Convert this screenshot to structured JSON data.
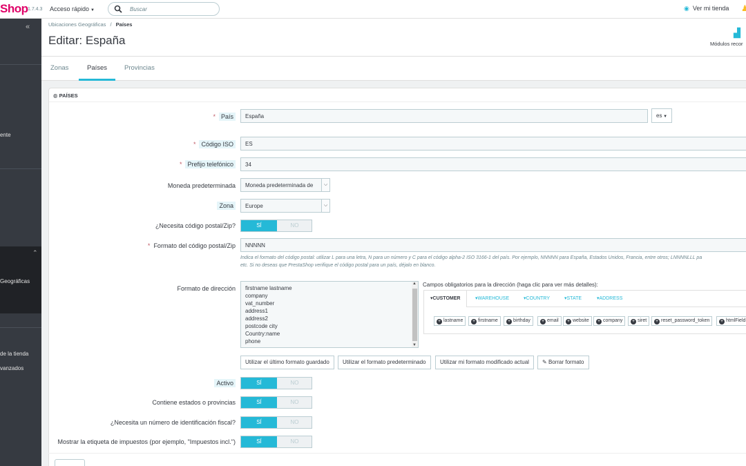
{
  "topbar": {
    "logo": "Shop",
    "version": "1.7.4.3",
    "quick_access": "Acceso rápido",
    "search_placeholder": "Buscar",
    "view_store": "Ver mi tienda"
  },
  "sidebar": {
    "items": [
      "ente",
      "Geográficas",
      "de la tienda",
      "vanzados"
    ]
  },
  "header": {
    "breadcrumb_parent": "Ubicaciones Geográficas",
    "breadcrumb_sep": "/",
    "breadcrumb_current": "Países",
    "title": "Editar: España",
    "modules_label": "Módulos recor",
    "tabs": [
      "Zonas",
      "Países",
      "Provincias"
    ]
  },
  "panel": {
    "title": "PAÍSES",
    "labels": {
      "country": "País",
      "iso": "Código ISO",
      "phone_prefix": "Prefijo telefónico",
      "currency": "Moneda predeterminada",
      "zone": "Zona",
      "zip_required": "¿Necesita código postal/Zip?",
      "zip_format": "Formato del código postal/Zip",
      "address_format": "Formato de dirección",
      "active": "Activo",
      "contains_states": "Contiene estados o provincias",
      "tax_id": "¿Necesita un número de identificación fiscal?",
      "tax_label": "Mostrar la etiqueta de impuestos (por ejemplo, \"Impuestos incl.\")"
    },
    "values": {
      "country": "España",
      "lang": "es",
      "iso": "ES",
      "phone_prefix": "34",
      "currency": "Moneda predeterminada de",
      "zone": "Europe",
      "zip_format": "NNNNN"
    },
    "switch": {
      "yes": "SÍ",
      "no": "NO"
    },
    "zip_help_1": "Indica el formato del código postal: utilizar L para una letra, N para un número y C para el código alpha-2 ISO 3166-1 del país. Por ejemplo, NNNNN para España, Estados Unidos, Francia, entre otros; LNNNNLLL pa",
    "zip_help_2": "etc. Si no deseas que PrestaShop verifique el código postal para un país, déjalo en blanco.",
    "address_lines": [
      "firstname lastname",
      "company",
      "vat_number",
      "address1",
      "address2",
      "postcode city",
      "Country:name",
      "phone"
    ],
    "fields_title": "Campos obligatorios para la dirección (haga clic para ver más detalles):",
    "field_tabs": [
      "CUSTOMER",
      "WAREHOUSE",
      "COUNTRY",
      "STATE",
      "ADDRESS"
    ],
    "field_chips": [
      "lastname",
      "firstname",
      "birthday",
      "email",
      "website",
      "company",
      "siret",
      "reset_password_token",
      "htmlField"
    ],
    "buttons": {
      "last_saved": "Utilizar el último formato guardado",
      "default": "Utilizar el formato predeterminado",
      "current": "Utilizar mi formato modificado actual",
      "clear": "Borrar formato"
    }
  },
  "colors": {
    "accent": "#25b9d7",
    "brand": "#df0067",
    "sidebar": "#363a41"
  }
}
